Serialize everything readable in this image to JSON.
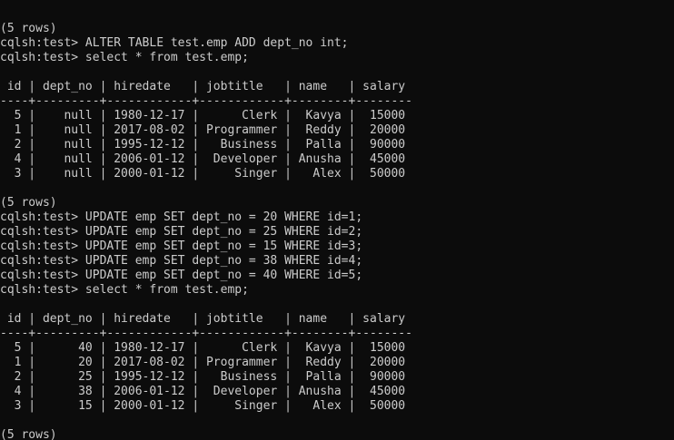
{
  "terminal": {
    "prompt": "cqlsh:test> ",
    "lines": [
      {
        "kind": "text",
        "text": "(5 rows)"
      },
      {
        "kind": "cmd",
        "text": "ALTER TABLE test.emp ADD dept_no int;"
      },
      {
        "kind": "cmd",
        "text": "select * from test.emp;"
      },
      {
        "kind": "blank",
        "text": ""
      },
      {
        "kind": "text",
        "text": " id | dept_no | hiredate   | jobtitle   | name   | salary"
      },
      {
        "kind": "text",
        "text": "----+---------+------------+------------+--------+--------"
      },
      {
        "kind": "text",
        "text": "  5 |    null | 1980-12-17 |      Clerk |  Kavya |  15000"
      },
      {
        "kind": "text",
        "text": "  1 |    null | 2017-08-02 | Programmer |  Reddy |  20000"
      },
      {
        "kind": "text",
        "text": "  2 |    null | 1995-12-12 |   Business |  Palla |  90000"
      },
      {
        "kind": "text",
        "text": "  4 |    null | 2006-01-12 |  Developer | Anusha |  45000"
      },
      {
        "kind": "text",
        "text": "  3 |    null | 2000-01-12 |     Singer |   Alex |  50000"
      },
      {
        "kind": "blank",
        "text": ""
      },
      {
        "kind": "text",
        "text": "(5 rows)"
      },
      {
        "kind": "cmd",
        "text": "UPDATE emp SET dept_no = 20 WHERE id=1;"
      },
      {
        "kind": "cmd",
        "text": "UPDATE emp SET dept_no = 25 WHERE id=2;"
      },
      {
        "kind": "cmd",
        "text": "UPDATE emp SET dept_no = 15 WHERE id=3;"
      },
      {
        "kind": "cmd",
        "text": "UPDATE emp SET dept_no = 38 WHERE id=4;"
      },
      {
        "kind": "cmd",
        "text": "UPDATE emp SET dept_no = 40 WHERE id=5;"
      },
      {
        "kind": "cmd",
        "text": "select * from test.emp;"
      },
      {
        "kind": "blank",
        "text": ""
      },
      {
        "kind": "text",
        "text": " id | dept_no | hiredate   | jobtitle   | name   | salary"
      },
      {
        "kind": "text",
        "text": "----+---------+------------+------------+--------+--------"
      },
      {
        "kind": "text",
        "text": "  5 |      40 | 1980-12-17 |      Clerk |  Kavya |  15000"
      },
      {
        "kind": "text",
        "text": "  1 |      20 | 2017-08-02 | Programmer |  Reddy |  20000"
      },
      {
        "kind": "text",
        "text": "  2 |      25 | 1995-12-12 |   Business |  Palla |  90000"
      },
      {
        "kind": "text",
        "text": "  4 |      38 | 2006-01-12 |  Developer | Anusha |  45000"
      },
      {
        "kind": "text",
        "text": "  3 |      15 | 2000-01-12 |     Singer |   Alex |  50000"
      },
      {
        "kind": "blank",
        "text": ""
      },
      {
        "kind": "text",
        "text": "(5 rows)"
      },
      {
        "kind": "cmd",
        "text": ""
      }
    ]
  },
  "colors": {
    "background": "#0c0c0c",
    "foreground": "#cccccc"
  }
}
